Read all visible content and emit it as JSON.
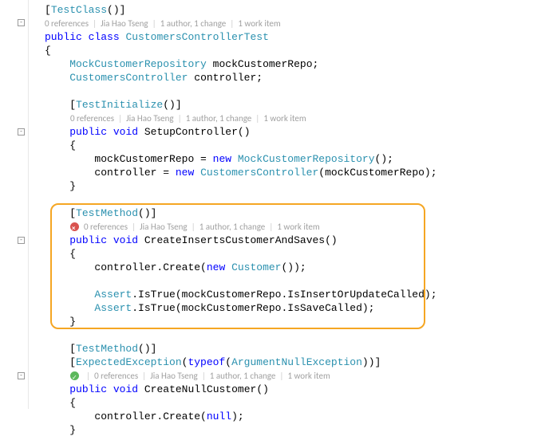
{
  "attr1": {
    "name": "TestClass"
  },
  "codelens1": {
    "refs": "0 references",
    "author": "Jia Hao Tseng",
    "changes": "1 author, 1 change",
    "work": "1 work item"
  },
  "classDecl": {
    "kw1": "public",
    "kw2": "class",
    "name": "CustomersControllerTest"
  },
  "field1": {
    "type": "MockCustomerRepository",
    "name": "mockCustomerRepo;"
  },
  "field2": {
    "type": "CustomersController",
    "name": "controller;"
  },
  "attr2": {
    "name": "TestInitialize"
  },
  "codelens2": {
    "refs": "0 references",
    "author": "Jia Hao Tseng",
    "changes": "1 author, 1 change",
    "work": "1 work item"
  },
  "method1": {
    "kw1": "public",
    "kw2": "void",
    "name": "SetupController"
  },
  "m1l1": {
    "a": "mockCustomerRepo = ",
    "kw": "new",
    "type": "MockCustomerRepository",
    "b": "();"
  },
  "m1l2": {
    "a": "controller = ",
    "kw": "new",
    "type": "CustomersController",
    "b": "(mockCustomerRepo);"
  },
  "attr3": {
    "name": "TestMethod"
  },
  "codelens3": {
    "refs": "0 references",
    "author": "Jia Hao Tseng",
    "changes": "1 author, 1 change",
    "work": "1 work item"
  },
  "method2": {
    "kw1": "public",
    "kw2": "void",
    "name": "CreateInsertsCustomerAndSaves"
  },
  "m2l1": {
    "a": "controller.Create(",
    "kw": "new",
    "type": "Customer",
    "b": "());"
  },
  "m2l2": {
    "type": "Assert",
    "b": ".IsTrue(mockCustomerRepo.IsInsertOrUpdateCalled);"
  },
  "m2l3": {
    "type": "Assert",
    "b": ".IsTrue(mockCustomerRepo.IsSaveCalled);"
  },
  "attr4": {
    "name": "TestMethod"
  },
  "attr5": {
    "name": "ExpectedException",
    "kw": "typeof",
    "arg": "ArgumentNullException"
  },
  "codelens4": {
    "refs": "0 references",
    "author": "Jia Hao Tseng",
    "changes": "1 author, 1 change",
    "work": "1 work item"
  },
  "method3": {
    "kw1": "public",
    "kw2": "void",
    "name": "CreateNullCustomer"
  },
  "m3l1": {
    "a": "controller.Create(",
    "kw": "null",
    "b": ");"
  },
  "braces": {
    "open": "{",
    "close": "}"
  }
}
